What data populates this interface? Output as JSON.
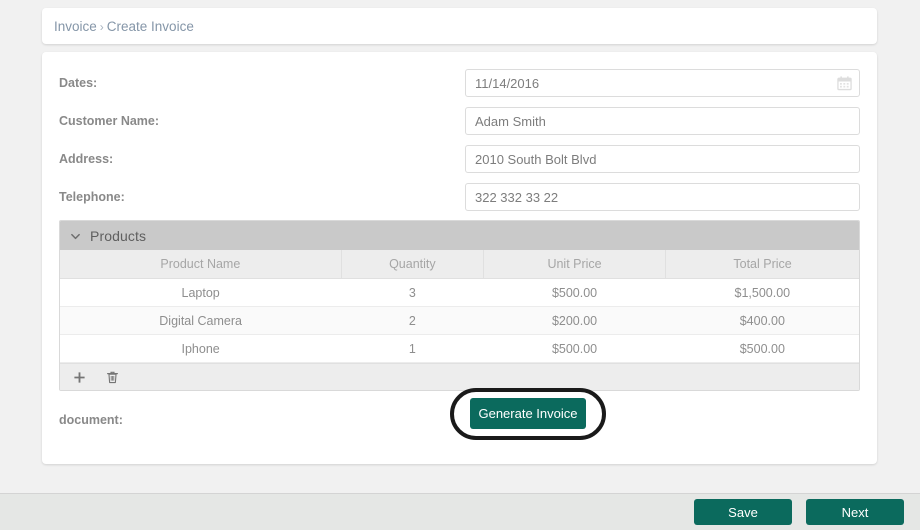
{
  "breadcrumb": {
    "root": "Invoice",
    "separator": "›",
    "current": "Create Invoice"
  },
  "form": {
    "fields": [
      {
        "label": "Dates:",
        "value": "11/14/2016",
        "icon": "calendar-icon"
      },
      {
        "label": "Customer Name:",
        "value": "Adam Smith",
        "icon": ""
      },
      {
        "label": "Address:",
        "value": "2010 South Bolt Blvd",
        "icon": ""
      },
      {
        "label": "Telephone:",
        "value": "322 332 33 22",
        "icon": ""
      }
    ],
    "document_label": "document:",
    "generate_button": "Generate Invoice"
  },
  "products": {
    "panel_title": "Products",
    "collapse_icon": "chevron-down-icon",
    "columns": [
      "Product Name",
      "Quantity",
      "Unit Price",
      "Total Price"
    ],
    "rows": [
      {
        "name": "Laptop",
        "quantity": "3",
        "unit_price": "$500.00",
        "total_price": "$1,500.00"
      },
      {
        "name": "Digital Camera",
        "quantity": "2",
        "unit_price": "$200.00",
        "total_price": "$400.00"
      },
      {
        "name": "Iphone",
        "quantity": "1",
        "unit_price": "$500.00",
        "total_price": "$500.00"
      }
    ],
    "footer_icons": [
      "add-icon",
      "delete-icon"
    ]
  },
  "action_bar": {
    "save_label": "Save",
    "next_label": "Next"
  },
  "colors": {
    "accent_teal": "#0b6a5d",
    "page_background": "#f1f1f1",
    "panel_header_gray": "#c9c9c9",
    "breadcrumb_text": "#8596a8",
    "highlight_ring": "#1a1a1a"
  }
}
